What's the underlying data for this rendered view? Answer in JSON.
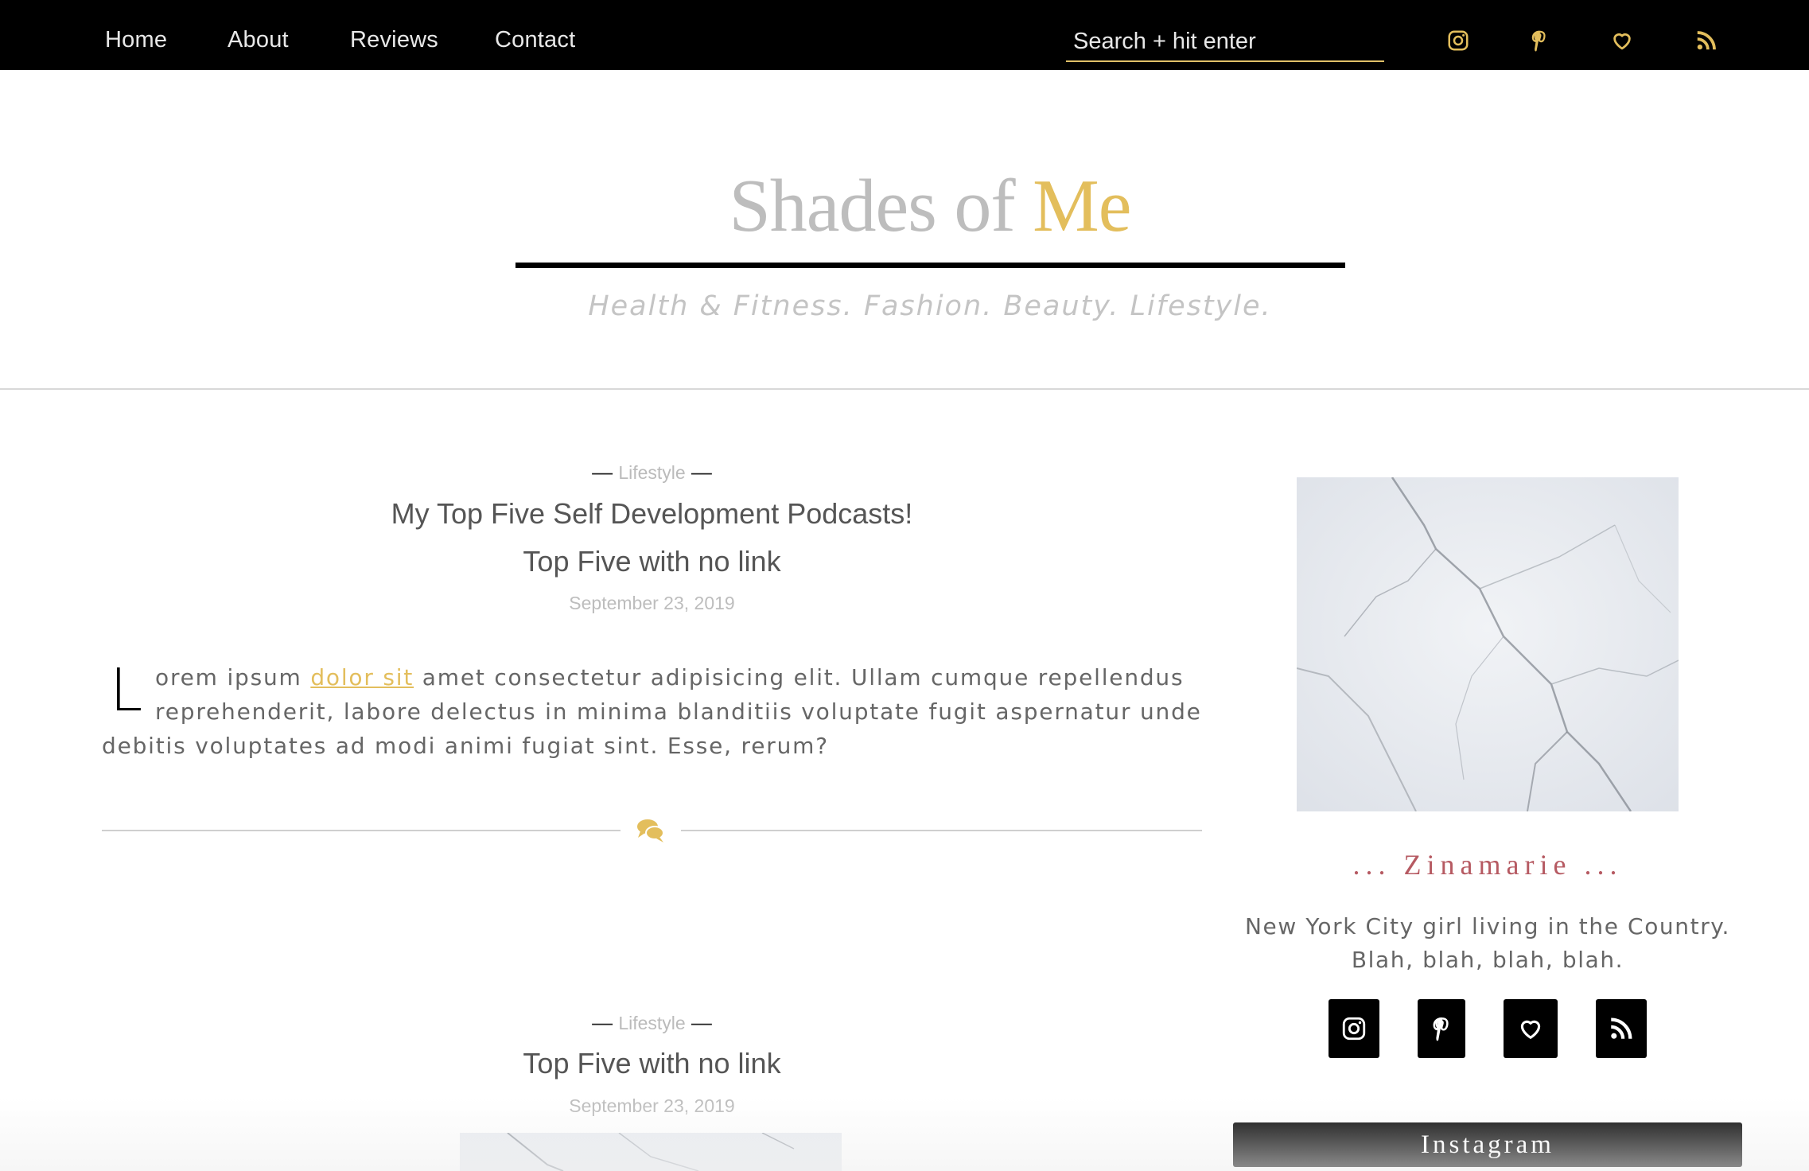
{
  "nav": {
    "links": [
      "Home",
      "About",
      "Reviews",
      "Contact"
    ],
    "search_placeholder": "Search + hit enter"
  },
  "header": {
    "title_main": "Shades of ",
    "title_accent": "Me",
    "tagline": "Health & Fitness. Fashion. Beauty. Lifestyle."
  },
  "posts": [
    {
      "category": "Lifestyle",
      "title_line1": "My Top Five Self Development Podcasts!",
      "title_line2": "Top Five with no link",
      "date": "September 23, 2019",
      "excerpt_dropcap": "L",
      "excerpt_before": "orem ipsum ",
      "excerpt_link": "dolor sit",
      "excerpt_after": " amet consectetur adipisicing elit. Ullam cumque repellendus reprehenderit, labore delectus in minima blanditiis voluptate fugit aspernatur unde debitis voluptates ad modi animi fugiat sint. Esse, rerum?"
    },
    {
      "category": "Lifestyle",
      "title_line1": "Top Five with no link",
      "date": "September 23, 2019"
    }
  ],
  "sidebar": {
    "author": "... Zinamarie ...",
    "bio_line1": "New York City girl living in the Country.",
    "bio_line2": "Blah, blah, blah, blah.",
    "instagram_label": "Instagram"
  },
  "colors": {
    "accent": "#e3be5c",
    "nav_bg": "#000000",
    "author": "#b65a62"
  },
  "icons": [
    "instagram-icon",
    "pinterest-icon",
    "heart-icon",
    "rss-icon",
    "comments-icon"
  ]
}
